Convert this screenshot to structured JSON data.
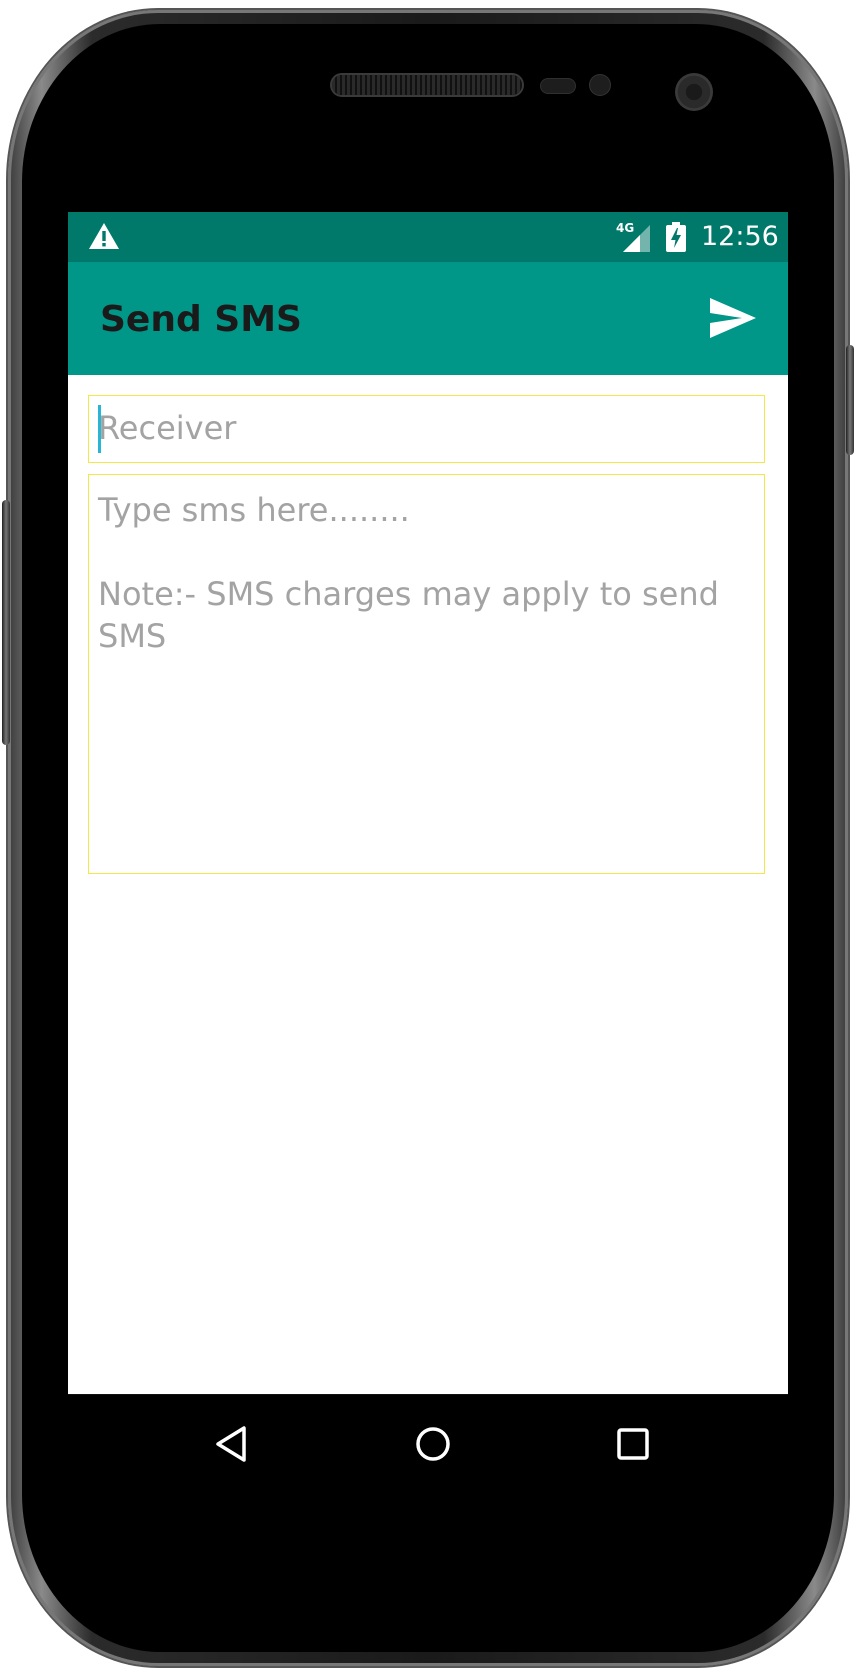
{
  "status_bar": {
    "time": "12:56",
    "network": "4G",
    "colors": {
      "background": "#00796b",
      "icon": "#ffffff"
    },
    "icons": [
      "warning-icon",
      "signal-icon",
      "battery-charging-icon"
    ]
  },
  "app_bar": {
    "title": "Send SMS",
    "action_icon": "send-icon",
    "colors": {
      "background": "#009688",
      "title": "#1a1a1a"
    }
  },
  "form": {
    "receiver": {
      "value": "",
      "placeholder": "Receiver"
    },
    "message": {
      "value": "",
      "placeholder": "Type sms here........\n\nNote:- SMS charges may apply to send SMS"
    },
    "colors": {
      "field_border": "#f4e74a",
      "placeholder": "#a3a3a3",
      "cursor": "#29b6d6"
    }
  },
  "nav_bar": {
    "icons": [
      "back-icon",
      "home-icon",
      "recents-icon"
    ]
  }
}
